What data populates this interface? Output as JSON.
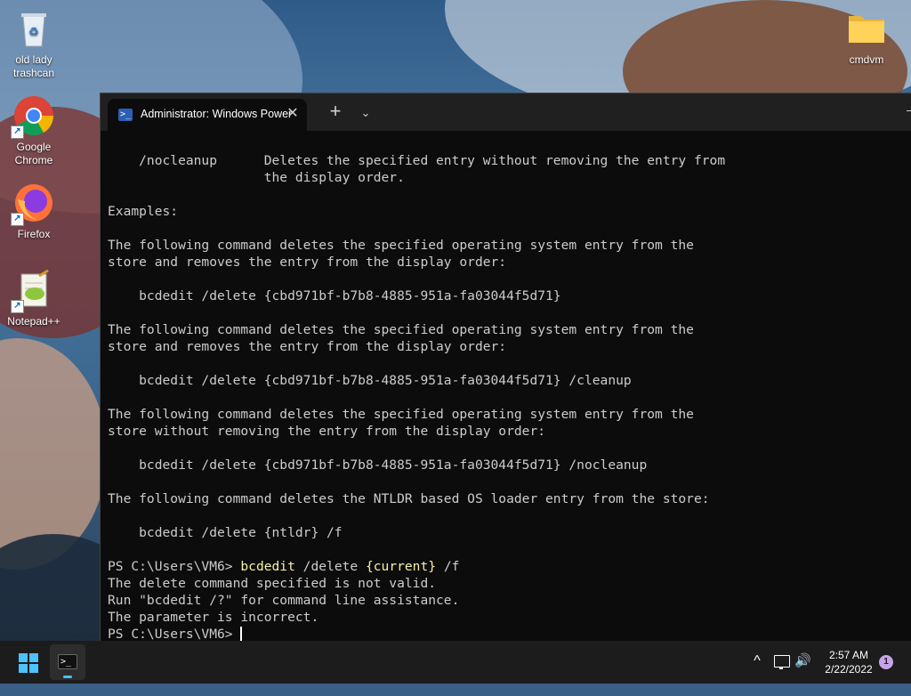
{
  "desktop": {
    "icons": [
      {
        "label": "old lady trashcan",
        "icon": "recycle-bin-icon"
      },
      {
        "label": "Google Chrome",
        "icon": "chrome-icon"
      },
      {
        "label": "Firefox",
        "icon": "firefox-icon"
      },
      {
        "label": "Notepad++",
        "icon": "notepad-plus-plus-icon"
      },
      {
        "label": "cmdvm",
        "icon": "folder-icon"
      }
    ]
  },
  "terminal": {
    "tab_title": "Administrator: Windows PowerShell",
    "tab_icon": "powershell-icon",
    "new_tab_glyph": "+",
    "dropdown_glyph": "⌄",
    "close_glyph": "✕",
    "colors": {
      "background": "#0c0c0c",
      "text": "#cccccc",
      "command": "#f9f1a5",
      "titlebar": "#202020"
    },
    "lines": [
      "    /nocleanup      Deletes the specified entry without removing the entry from",
      "                    the display order.",
      "",
      "Examples:",
      "",
      "The following command deletes the specified operating system entry from the",
      "store and removes the entry from the display order:",
      "",
      "    bcdedit /delete {cbd971bf-b7b8-4885-951a-fa03044f5d71}",
      "",
      "The following command deletes the specified operating system entry from the",
      "store and removes the entry from the display order:",
      "",
      "    bcdedit /delete {cbd971bf-b7b8-4885-951a-fa03044f5d71} /cleanup",
      "",
      "The following command deletes the specified operating system entry from the",
      "store without removing the entry from the display order:",
      "",
      "    bcdedit /delete {cbd971bf-b7b8-4885-951a-fa03044f5d71} /nocleanup",
      "",
      "The following command deletes the NTLDR based OS loader entry from the store:",
      "",
      "    bcdedit /delete {ntldr} /f",
      ""
    ],
    "prompt": "PS C:\\Users\\VM6> ",
    "last_command": {
      "exe": "bcdedit",
      "args_before": " /delete ",
      "highlight": "{current}",
      "args_after": " /f"
    },
    "output_lines": [
      "The delete command specified is not valid.",
      "Run \"bcdedit /?\" for command line assistance.",
      "The parameter is incorrect."
    ],
    "current_prompt": "PS C:\\Users\\VM6> "
  },
  "taskbar": {
    "start_icon": "windows-start-icon",
    "pinned": [
      {
        "name": "Windows Terminal",
        "icon": "terminal-icon"
      }
    ],
    "tray_chevron": "^",
    "clock_time": "2:57 AM",
    "clock_date": "2/22/2022",
    "notification_count": "1",
    "accent": "#4cc2ff"
  }
}
